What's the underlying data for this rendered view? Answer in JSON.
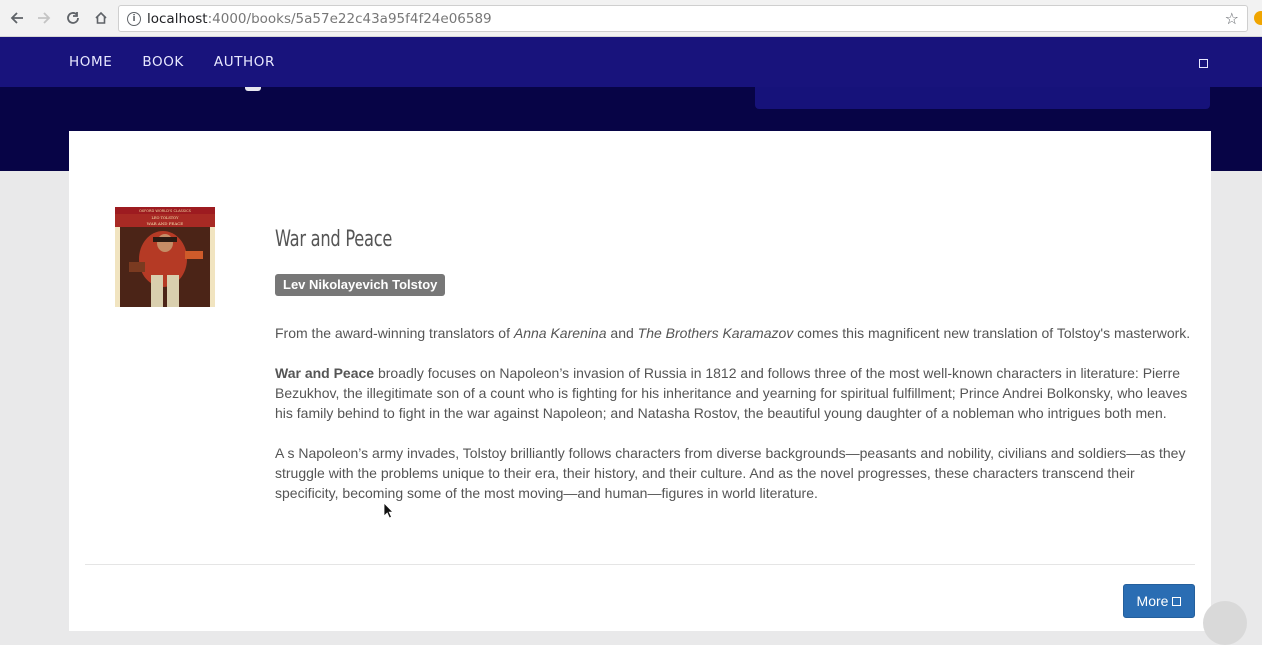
{
  "browser": {
    "url_host": "localhost",
    "url_path": ":4000/books/5a57e22c43a95f4f24e06589"
  },
  "nav": {
    "links": [
      "HOME",
      "BOOK",
      "AUTHOR"
    ]
  },
  "book": {
    "title": "War and Peace",
    "author": "Lev Nikolayevich Tolstoy",
    "cover_top_line": "OXFORD WORLD'S CLASSICS",
    "cover_author": "LEO TOLSTOY",
    "cover_title": "WAR AND PEACE",
    "p1_pre": "From the award-winning translators of ",
    "p1_em1": "Anna Karenina",
    "p1_mid": " and ",
    "p1_em2": "The Brothers Karamazov",
    "p1_post": " comes this magnificent new translation of Tolstoy's masterwork.",
    "p2_strong": "War and Peace",
    "p2_rest": " broadly focuses on Napoleon’s invasion of Russia in 1812 and follows three of the most well-known characters in literature: Pierre Bezukhov, the illegitimate son of a count who is fighting for his inheritance and yearning for spiritual fulfillment; Prince Andrei Bolkonsky, who leaves his family behind to fight in the war against Napoleon; and Natasha Rostov, the beautiful young daughter of a nobleman who intrigues both men.",
    "p3": "A s Napoleon’s army invades, Tolstoy brilliantly follows characters from diverse backgrounds—peasants and nobility, civilians and soldiers—as they struggle with the problems unique to their era, their history, and their culture. And as the novel progresses, these characters transcend their specificity, becoming some of the most moving—and human—figures in world literature."
  },
  "actions": {
    "more_label": "More"
  },
  "colors": {
    "nav_bg": "#18137c",
    "hero_bg": "#070446",
    "badge_bg": "#777777",
    "button_bg": "#2a6db3"
  },
  "icons": [
    "back-arrow-icon",
    "forward-arrow-icon",
    "reload-icon",
    "home-icon",
    "info-icon",
    "bookmark-star-icon",
    "menu-toggle-icon",
    "external-icon"
  ]
}
